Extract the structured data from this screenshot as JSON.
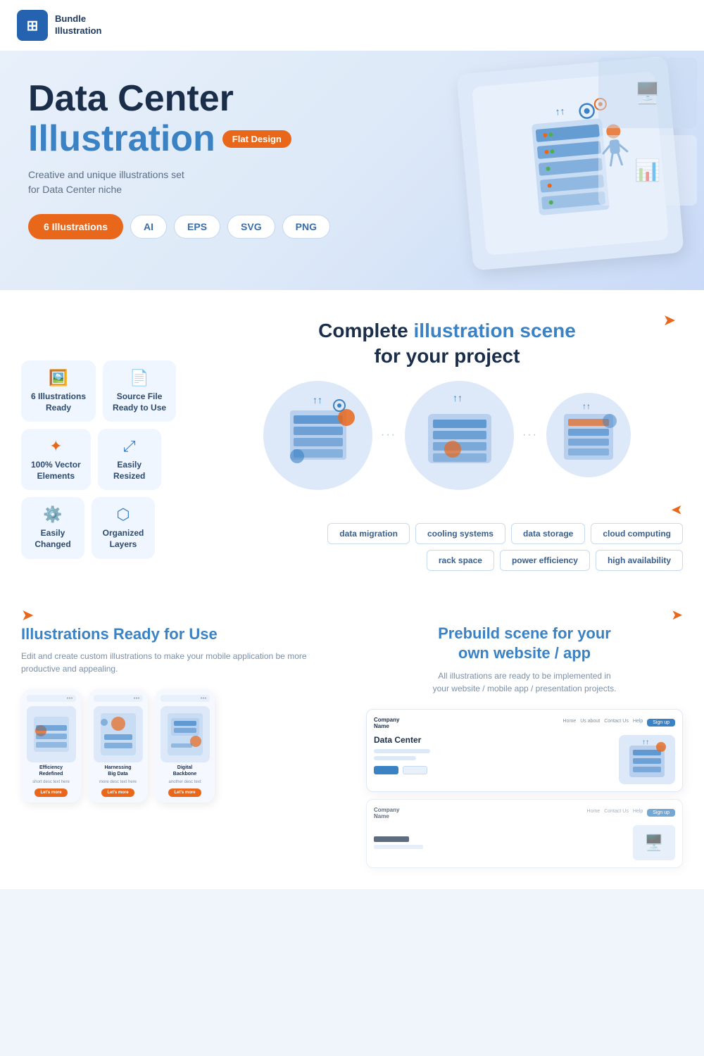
{
  "header": {
    "logo_label": "Bundle\nIllustration"
  },
  "hero": {
    "title": "Data Center",
    "subtitle": "Illustration",
    "badge": "Flat Design",
    "description_line1": "Creative and unique illustrations set",
    "description_line2": "for Data Center niche",
    "formats": {
      "count_label": "6 Illustrations",
      "tags": [
        "AI",
        "EPS",
        "SVG",
        "PNG"
      ]
    }
  },
  "features": {
    "section_title_part1": "Complete",
    "section_title_part2": "illustration scene",
    "section_title_part3": "for your project",
    "items": [
      {
        "label": "6 Illustrations\nReady",
        "icon": "🖼️"
      },
      {
        "label": "Source File\nReady to Use",
        "icon": "📄"
      },
      {
        "label": "100% Vector\nElements",
        "icon": "✦"
      },
      {
        "label": "Easily\nResized",
        "icon": "⤢"
      },
      {
        "label": "Easily\nChanged",
        "icon": "⚙️"
      },
      {
        "label": "Organized\nLayers",
        "icon": "⬡"
      }
    ],
    "topic_tags": [
      "data migration",
      "cooling systems",
      "data storage",
      "cloud computing",
      "rack space",
      "power efficiency",
      "high availability"
    ]
  },
  "illustrations_section": {
    "title_part1": "Illustrations",
    "title_part2": "Ready for Use",
    "description": "Edit and create custom illustrations to make your mobile application be more productive and appealing.",
    "cards": [
      {
        "title": "Efficiency\nRedefined",
        "desc": "short desc text here"
      },
      {
        "title": "Harnessing\nBig Data",
        "desc": "more desc text here"
      },
      {
        "title": "Digital\nBackbone",
        "desc": "another desc text"
      }
    ],
    "btn_label": "Let's more"
  },
  "prebuild_section": {
    "title_part1": "Prebuild scene",
    "title_part2": "for your\nown website / app",
    "description": "All illustrations are ready to be implemented in\nyour website / mobile app / presentation projects.",
    "website_mockup": {
      "logo": "Company\nName",
      "nav_links": [
        "Home",
        "Us about",
        "Contact Us",
        "Help"
      ],
      "nav_btn": "Sign up",
      "hero_title": "Data Center"
    }
  }
}
